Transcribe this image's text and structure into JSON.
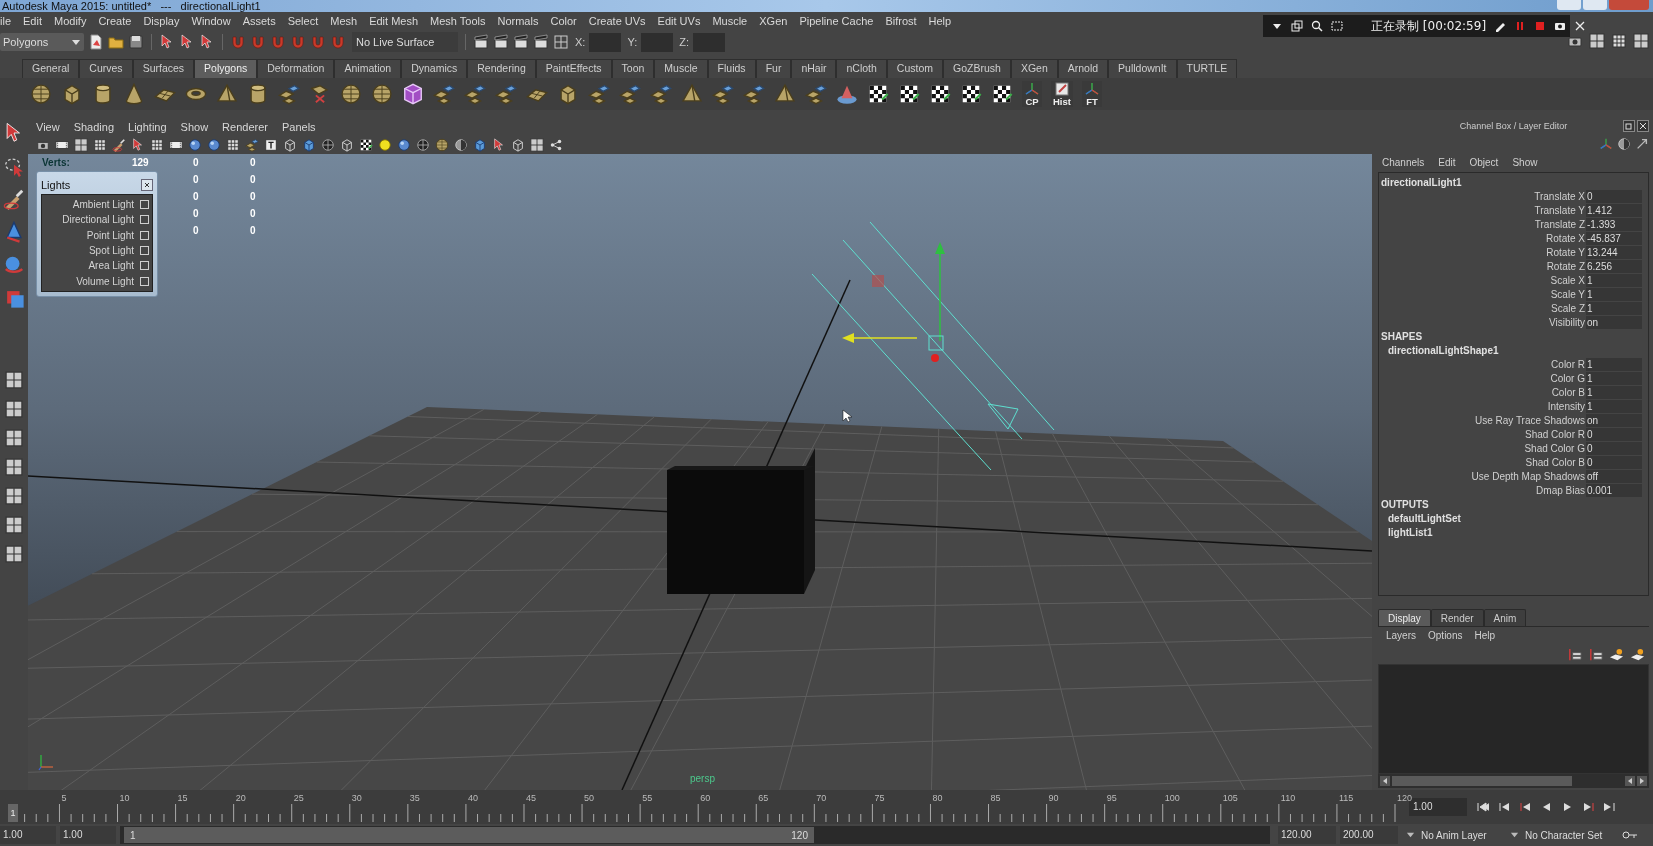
{
  "window": {
    "title": "Autodesk Maya 2015: untitled*   ---   directionalLight1"
  },
  "menu_bar": [
    "ile",
    "Edit",
    "Modify",
    "Create",
    "Display",
    "Window",
    "Assets",
    "Select",
    "Mesh",
    "Edit Mesh",
    "Mesh Tools",
    "Normals",
    "Color",
    "Create UVs",
    "Edit UVs",
    "Muscle",
    "XGen",
    "Pipeline Cache",
    "Bifrost",
    "Help"
  ],
  "recorder": {
    "status": "正在录制 [00:02:59]"
  },
  "status_line": {
    "mode": "Polygons",
    "live_surface": "No Live Surface",
    "coord_labels": [
      "X:",
      "Y:",
      "Z:"
    ]
  },
  "shelf": {
    "tabs": [
      {
        "label": "General",
        "selected": false
      },
      {
        "label": "Curves",
        "selected": false
      },
      {
        "label": "Surfaces",
        "selected": false
      },
      {
        "label": "Polygons",
        "selected": true
      },
      {
        "label": "Deformation",
        "selected": false
      },
      {
        "label": "Animation",
        "selected": false
      },
      {
        "label": "Dynamics",
        "selected": false
      },
      {
        "label": "Rendering",
        "selected": false
      },
      {
        "label": "PaintEffects",
        "selected": false
      },
      {
        "label": "Toon",
        "selected": false
      },
      {
        "label": "Muscle",
        "selected": false
      },
      {
        "label": "Fluids",
        "selected": false
      },
      {
        "label": "Fur",
        "selected": false
      },
      {
        "label": "nHair",
        "selected": false
      },
      {
        "label": "nCloth",
        "selected": false
      },
      {
        "label": "Custom",
        "selected": false
      },
      {
        "label": "GoZBrush",
        "selected": false
      },
      {
        "label": "XGen",
        "selected": false
      },
      {
        "label": "Arnold",
        "selected": false
      },
      {
        "label": "PulldownIt",
        "selected": false
      },
      {
        "label": "TURTLE",
        "selected": false
      }
    ],
    "text_buttons": [
      "CP",
      "Hist",
      "FT"
    ]
  },
  "viewport": {
    "menu": [
      "View",
      "Shading",
      "Lighting",
      "Show",
      "Renderer",
      "Panels"
    ],
    "hud": [
      {
        "label": "Verts:",
        "values": [
          "129",
          "0",
          "0"
        ]
      },
      {
        "values": [
          "0",
          "0"
        ]
      },
      {
        "values": [
          "0",
          "0"
        ]
      },
      {
        "values": [
          "0",
          "0"
        ]
      },
      {
        "values": [
          "0",
          "0"
        ]
      }
    ],
    "camera_label": "persp"
  },
  "lights_window": {
    "title": "Lights",
    "items": [
      {
        "label": "Ambient Light",
        "checked": false
      },
      {
        "label": "Directional Light",
        "checked": false
      },
      {
        "label": "Point Light",
        "checked": false
      },
      {
        "label": "Spot Light",
        "checked": false
      },
      {
        "label": "Area Light",
        "checked": false
      },
      {
        "label": "Volume Light",
        "checked": false
      }
    ]
  },
  "channel_box": {
    "title": "Channel Box / Layer Editor",
    "menu": [
      "Channels",
      "Edit",
      "Object",
      "Show"
    ],
    "object": "directionalLight1",
    "attributes": [
      {
        "label": "Translate X",
        "value": "0"
      },
      {
        "label": "Translate Y",
        "value": "1.412"
      },
      {
        "label": "Translate Z",
        "value": "-1.393"
      },
      {
        "label": "Rotate X",
        "value": "-45.837"
      },
      {
        "label": "Rotate Y",
        "value": "13.244"
      },
      {
        "label": "Rotate Z",
        "value": "6.256"
      },
      {
        "label": "Scale X",
        "value": "1"
      },
      {
        "label": "Scale Y",
        "value": "1"
      },
      {
        "label": "Scale Z",
        "value": "1"
      },
      {
        "label": "Visibility",
        "value": "on"
      }
    ],
    "shapes_heading": "SHAPES",
    "shape": "directionalLightShape1",
    "shape_attributes": [
      {
        "label": "Color R",
        "value": "1"
      },
      {
        "label": "Color G",
        "value": "1"
      },
      {
        "label": "Color B",
        "value": "1"
      },
      {
        "label": "Intensity",
        "value": "1"
      },
      {
        "label": "Use Ray Trace Shadows",
        "value": "on"
      },
      {
        "label": "Shad Color R",
        "value": "0"
      },
      {
        "label": "Shad Color G",
        "value": "0"
      },
      {
        "label": "Shad Color B",
        "value": "0"
      },
      {
        "label": "Use Depth Map Shadows",
        "value": "off"
      },
      {
        "label": "Dmap Bias",
        "value": "0.001"
      }
    ],
    "outputs_heading": "OUTPUTS",
    "outputs": [
      "defaultLightSet",
      "lightList1"
    ]
  },
  "layer_editor": {
    "tabs": [
      {
        "label": "Display",
        "selected": true
      },
      {
        "label": "Render",
        "selected": false
      },
      {
        "label": "Anim",
        "selected": false
      }
    ],
    "menu": [
      "Layers",
      "Options",
      "Help"
    ]
  },
  "timeline": {
    "current_frame": "1",
    "level": 0,
    "labels": [
      "5",
      "10",
      "15",
      "20",
      "25",
      "30",
      "35",
      "40",
      "45",
      "50",
      "55",
      "60",
      "65",
      "70",
      "75",
      "80",
      "85",
      "90",
      "95",
      "100",
      "105",
      "110",
      "115",
      "120"
    ],
    "current_time": "1.00"
  },
  "range_slider": {
    "start_time": "1.00",
    "playback_start": "1.00",
    "range_start": "1",
    "range_end": "120",
    "playback_end": "120.00",
    "end_time": "200.00",
    "anim_layer": "No Anim Layer",
    "character_set": "No Character Set"
  }
}
